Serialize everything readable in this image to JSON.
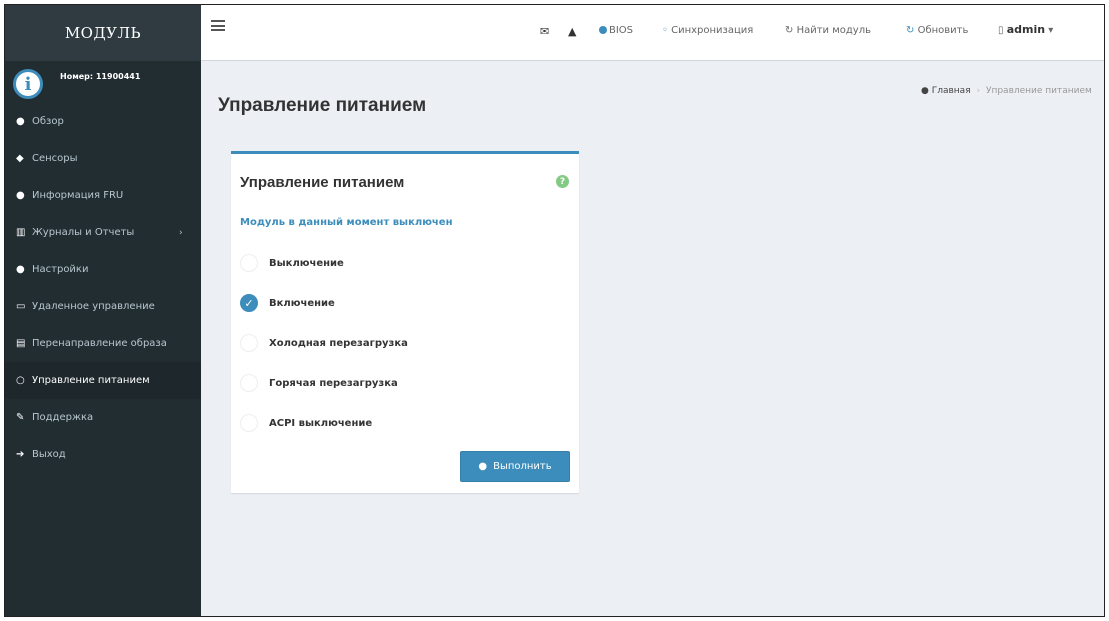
{
  "brand": "МОДУЛЬ",
  "user": {
    "info_glyph": "i",
    "number": "Номер: 11900441"
  },
  "menu": [
    {
      "icon": "home-icon",
      "glyph": "●",
      "label": "Обзор"
    },
    {
      "icon": "sensors-icon",
      "glyph": "◆",
      "label": "Сенсоры"
    },
    {
      "icon": "info-icon",
      "glyph": "●",
      "label": "Информация FRU"
    },
    {
      "icon": "chart-icon",
      "glyph": "▥",
      "label": "Журналы и Отчеты",
      "caret": "›"
    },
    {
      "icon": "gear-icon",
      "glyph": "●",
      "label": "Настройки"
    },
    {
      "icon": "monitor-icon",
      "glyph": "▭",
      "label": "Удаленное управление"
    },
    {
      "icon": "drive-icon",
      "glyph": "▤",
      "label": "Перенаправление образа"
    },
    {
      "icon": "power-icon",
      "glyph": "○",
      "label": "Управление питанием",
      "active": true
    },
    {
      "icon": "wrench-icon",
      "glyph": "✎",
      "label": "Поддержка"
    },
    {
      "icon": "logout-icon",
      "glyph": "➔",
      "label": "Выход"
    }
  ],
  "topbar": {
    "envelope_glyph": "✉",
    "warning_glyph": "▲",
    "bios": "BIOS",
    "sync": "Синхронизация",
    "find_module": "Найти модуль",
    "refresh": "Обновить",
    "admin": "admin",
    "admin_caret": "▾",
    "sync_glyph": "◦",
    "find_glyph": "↻",
    "refresh_glyph": "↻",
    "admin_glyph": "▯"
  },
  "page": {
    "title": "Управление питанием",
    "breadcrumb_home": "Главная",
    "breadcrumb_sep": "›",
    "breadcrumb_current": "Управление питанием"
  },
  "panel": {
    "title": "Управление питанием",
    "help_glyph": "?",
    "status": "Модуль в данный момент выключен",
    "options": [
      {
        "label": "Выключение",
        "checked": false
      },
      {
        "label": "Включение",
        "checked": true
      },
      {
        "label": "Холодная перезагрузка",
        "checked": false
      },
      {
        "label": "Горячая перезагрузка",
        "checked": false
      },
      {
        "label": "ACPI выключение",
        "checked": false
      }
    ],
    "execute_label": "Выполнить",
    "execute_glyph": "●"
  },
  "colors": {
    "accent": "#3c8dbc",
    "sidebar": "#222d32",
    "sidebar_active": "#1e282c",
    "content_bg": "#ecf0f5"
  }
}
